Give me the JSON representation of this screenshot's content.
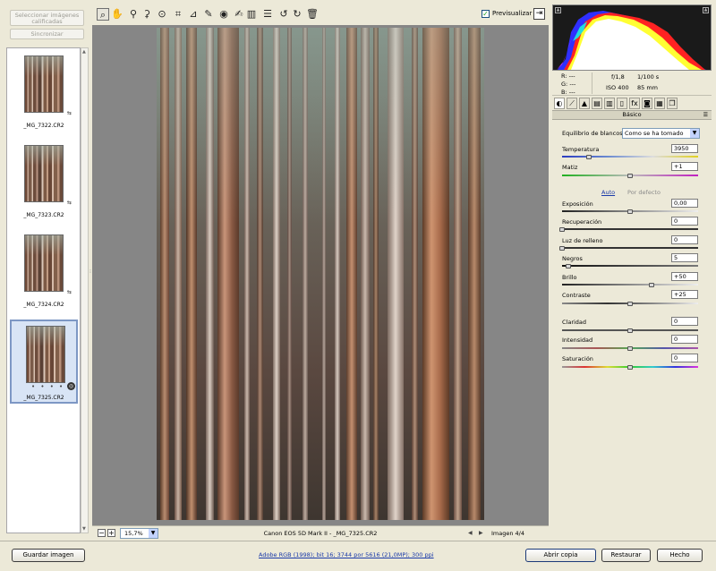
{
  "filmstrip": {
    "select_rated_label": "Seleccionar imágenes calificadas",
    "sync_label": "Sincronizar",
    "thumbnails": [
      {
        "name": "_MG_7322.CR2",
        "selected": false
      },
      {
        "name": "_MG_7323.CR2",
        "selected": false
      },
      {
        "name": "_MG_7324.CR2",
        "selected": false
      },
      {
        "name": "_MG_7325.CR2",
        "selected": true,
        "rating_dots": "• • • • •"
      }
    ]
  },
  "toolbar": {
    "tools": [
      "zoom-icon",
      "hand-icon",
      "white-balance-icon",
      "color-sampler-icon",
      "target-adjust-icon",
      "crop-icon",
      "straighten-icon",
      "spot-removal-icon",
      "red-eye-icon",
      "adjustment-brush-icon",
      "graduated-filter-icon",
      "preferences-icon",
      "rotate-left-icon",
      "rotate-right-icon",
      "trash-icon"
    ],
    "preview_label": "Previsualizar",
    "preview_checked": true
  },
  "image_area": {
    "zoom_value": "15,7%",
    "camera_file": "Canon EOS 5D Mark II -  _MG_7325.CR2",
    "image_counter": "Imagen 4/4"
  },
  "info": {
    "r_label": "R:",
    "g_label": "G:",
    "b_label": "B:",
    "r_value": "---",
    "g_value": "---",
    "b_value": "---",
    "aperture": "f/1,8",
    "shutter": "1/100 s",
    "iso": "ISO 400",
    "focal": "85 mm"
  },
  "panel": {
    "title": "Básico",
    "wb_label": "Equilibrio de blancos:",
    "wb_value": "Como se ha tomado",
    "auto_label": "Auto",
    "default_label": "Por defecto",
    "sliders": {
      "temperatura": {
        "label": "Temperatura",
        "value": "3950"
      },
      "matiz": {
        "label": "Matiz",
        "value": "+1"
      },
      "exposicion": {
        "label": "Exposición",
        "value": "0,00"
      },
      "recuperacion": {
        "label": "Recuperación",
        "value": "0"
      },
      "luz": {
        "label": "Luz de relleno",
        "value": "0"
      },
      "negros": {
        "label": "Negros",
        "value": "5"
      },
      "brillo": {
        "label": "Brillo",
        "value": "+50"
      },
      "contraste": {
        "label": "Contraste",
        "value": "+25"
      },
      "claridad": {
        "label": "Claridad",
        "value": "0"
      },
      "intensidad": {
        "label": "Intensidad",
        "value": "0"
      },
      "saturacion": {
        "label": "Saturación",
        "value": "0"
      }
    }
  },
  "footer": {
    "save_label": "Guardar imagen",
    "workflow_link": "Adobe RGB (1998); bit 16; 3744 por 5616 (21,0MP); 300 ppi",
    "open_label": "Abrir copia",
    "reset_label": "Restaurar",
    "done_label": "Hecho"
  },
  "colors": {
    "accent": "#1a3aa9",
    "panel_bg": "#ece9d8",
    "canvas_bg": "#868686"
  }
}
